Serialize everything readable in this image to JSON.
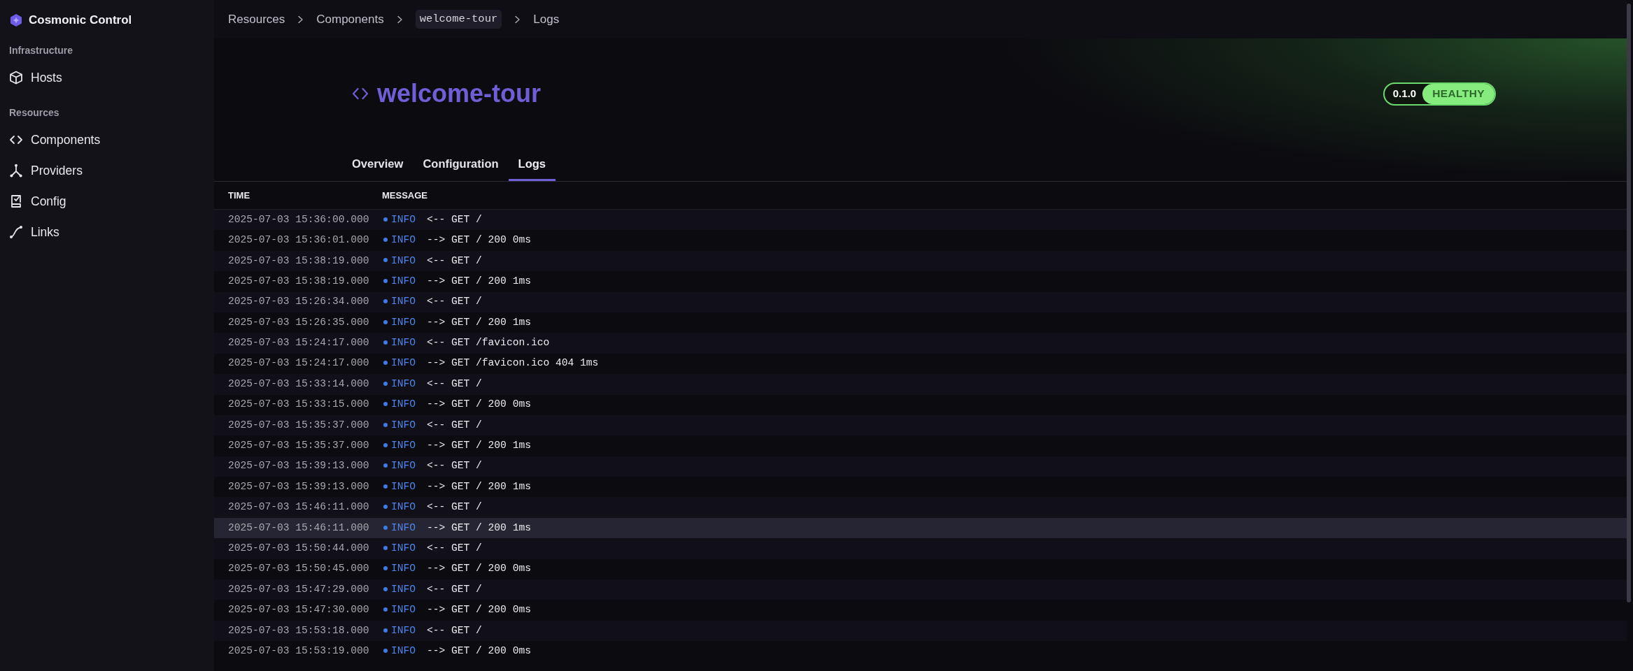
{
  "sidebar": {
    "brand": "Cosmonic Control",
    "sections": [
      {
        "heading": "Infrastructure",
        "items": [
          {
            "label": "Hosts"
          }
        ]
      },
      {
        "heading": "Resources",
        "items": [
          {
            "label": "Components"
          },
          {
            "label": "Providers"
          },
          {
            "label": "Config"
          },
          {
            "label": "Links"
          }
        ]
      }
    ]
  },
  "breadcrumb": [
    {
      "label": "Resources",
      "kind": "link"
    },
    {
      "label": "Components",
      "kind": "link"
    },
    {
      "label": "welcome-tour",
      "kind": "code"
    },
    {
      "label": "Logs",
      "kind": "current"
    }
  ],
  "header": {
    "title": "welcome-tour",
    "version": "0.1.0",
    "status": "HEALTHY"
  },
  "tabs": [
    {
      "label": "Overview",
      "selected": false
    },
    {
      "label": "Configuration",
      "selected": false
    },
    {
      "label": "Logs",
      "selected": true
    }
  ],
  "table": {
    "columns": [
      "TIME",
      "MESSAGE"
    ],
    "rows": [
      {
        "time": "2025-07-03 15:36:00.000",
        "severity": "INFO",
        "message": "<-- GET /",
        "hovered": false
      },
      {
        "time": "2025-07-03 15:36:01.000",
        "severity": "INFO",
        "message": "--> GET / 200 0ms",
        "hovered": false
      },
      {
        "time": "2025-07-03 15:38:19.000",
        "severity": "INFO",
        "message": "<-- GET /",
        "hovered": false
      },
      {
        "time": "2025-07-03 15:38:19.000",
        "severity": "INFO",
        "message": "--> GET / 200 1ms",
        "hovered": false
      },
      {
        "time": "2025-07-03 15:26:34.000",
        "severity": "INFO",
        "message": "<-- GET /",
        "hovered": false
      },
      {
        "time": "2025-07-03 15:26:35.000",
        "severity": "INFO",
        "message": "--> GET / 200 1ms",
        "hovered": false
      },
      {
        "time": "2025-07-03 15:24:17.000",
        "severity": "INFO",
        "message": "<-- GET /favicon.ico",
        "hovered": false
      },
      {
        "time": "2025-07-03 15:24:17.000",
        "severity": "INFO",
        "message": "--> GET /favicon.ico 404 1ms",
        "hovered": false
      },
      {
        "time": "2025-07-03 15:33:14.000",
        "severity": "INFO",
        "message": "<-- GET /",
        "hovered": false
      },
      {
        "time": "2025-07-03 15:33:15.000",
        "severity": "INFO",
        "message": "--> GET / 200 0ms",
        "hovered": false
      },
      {
        "time": "2025-07-03 15:35:37.000",
        "severity": "INFO",
        "message": "<-- GET /",
        "hovered": false
      },
      {
        "time": "2025-07-03 15:35:37.000",
        "severity": "INFO",
        "message": "--> GET / 200 1ms",
        "hovered": false
      },
      {
        "time": "2025-07-03 15:39:13.000",
        "severity": "INFO",
        "message": "<-- GET /",
        "hovered": false
      },
      {
        "time": "2025-07-03 15:39:13.000",
        "severity": "INFO",
        "message": "--> GET / 200 1ms",
        "hovered": false
      },
      {
        "time": "2025-07-03 15:46:11.000",
        "severity": "INFO",
        "message": "<-- GET /",
        "hovered": false
      },
      {
        "time": "2025-07-03 15:46:11.000",
        "severity": "INFO",
        "message": "--> GET / 200 1ms",
        "hovered": true
      },
      {
        "time": "2025-07-03 15:50:44.000",
        "severity": "INFO",
        "message": "<-- GET /",
        "hovered": false
      },
      {
        "time": "2025-07-03 15:50:45.000",
        "severity": "INFO",
        "message": "--> GET / 200 0ms",
        "hovered": false
      },
      {
        "time": "2025-07-03 15:47:29.000",
        "severity": "INFO",
        "message": "<-- GET /",
        "hovered": false
      },
      {
        "time": "2025-07-03 15:47:30.000",
        "severity": "INFO",
        "message": "--> GET / 200 0ms",
        "hovered": false
      },
      {
        "time": "2025-07-03 15:53:18.000",
        "severity": "INFO",
        "message": "<-- GET /",
        "hovered": false
      },
      {
        "time": "2025-07-03 15:53:19.000",
        "severity": "INFO",
        "message": "--> GET / 200 0ms",
        "hovered": false
      }
    ]
  }
}
